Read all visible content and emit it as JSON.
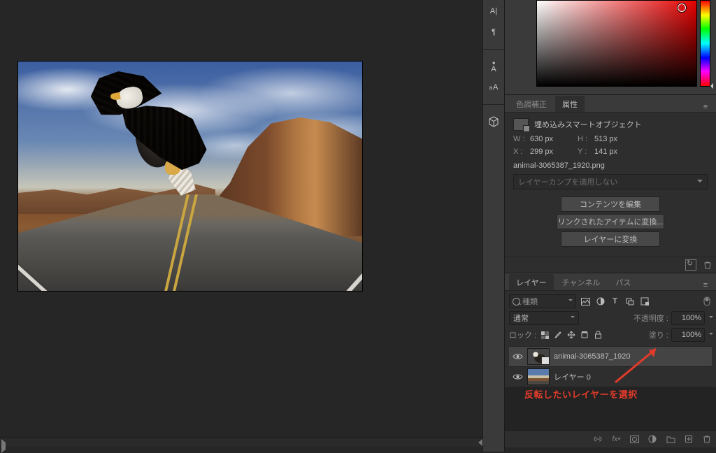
{
  "properties": {
    "tabs": {
      "color_correction": "色調補正",
      "attributes": "属性"
    },
    "title": "埋め込みスマートオブジェクト",
    "width_label": "W :",
    "width": "630 px",
    "height_label": "H :",
    "height": "513 px",
    "x_label": "X :",
    "x": "299 px",
    "y_label": "Y :",
    "y": "141 px",
    "filename": "animal-3065387_1920.png",
    "layer_comp_placeholder": "レイヤーカンプを適用しない",
    "buttons": {
      "edit_contents": "コンテンツを編集",
      "convert_linked": "リンクされたアイテムに変換...",
      "convert_layer": "レイヤーに変換"
    }
  },
  "layers_panel": {
    "tabs": {
      "layers": "レイヤー",
      "channels": "チャンネル",
      "paths": "パス"
    },
    "filter_label": "種類",
    "blend_mode": "通常",
    "opacity_label": "不透明度 :",
    "opacity_value": "100%",
    "lock_label": "ロック :",
    "fill_label": "塗り :",
    "fill_value": "100%",
    "layers": [
      {
        "name": "animal-3065387_1920",
        "selected": true,
        "smart": true
      },
      {
        "name": "レイヤー 0",
        "selected": false,
        "smart": false
      }
    ]
  },
  "annotation": "反転したいレイヤーを選択",
  "footer_fx": "fx"
}
